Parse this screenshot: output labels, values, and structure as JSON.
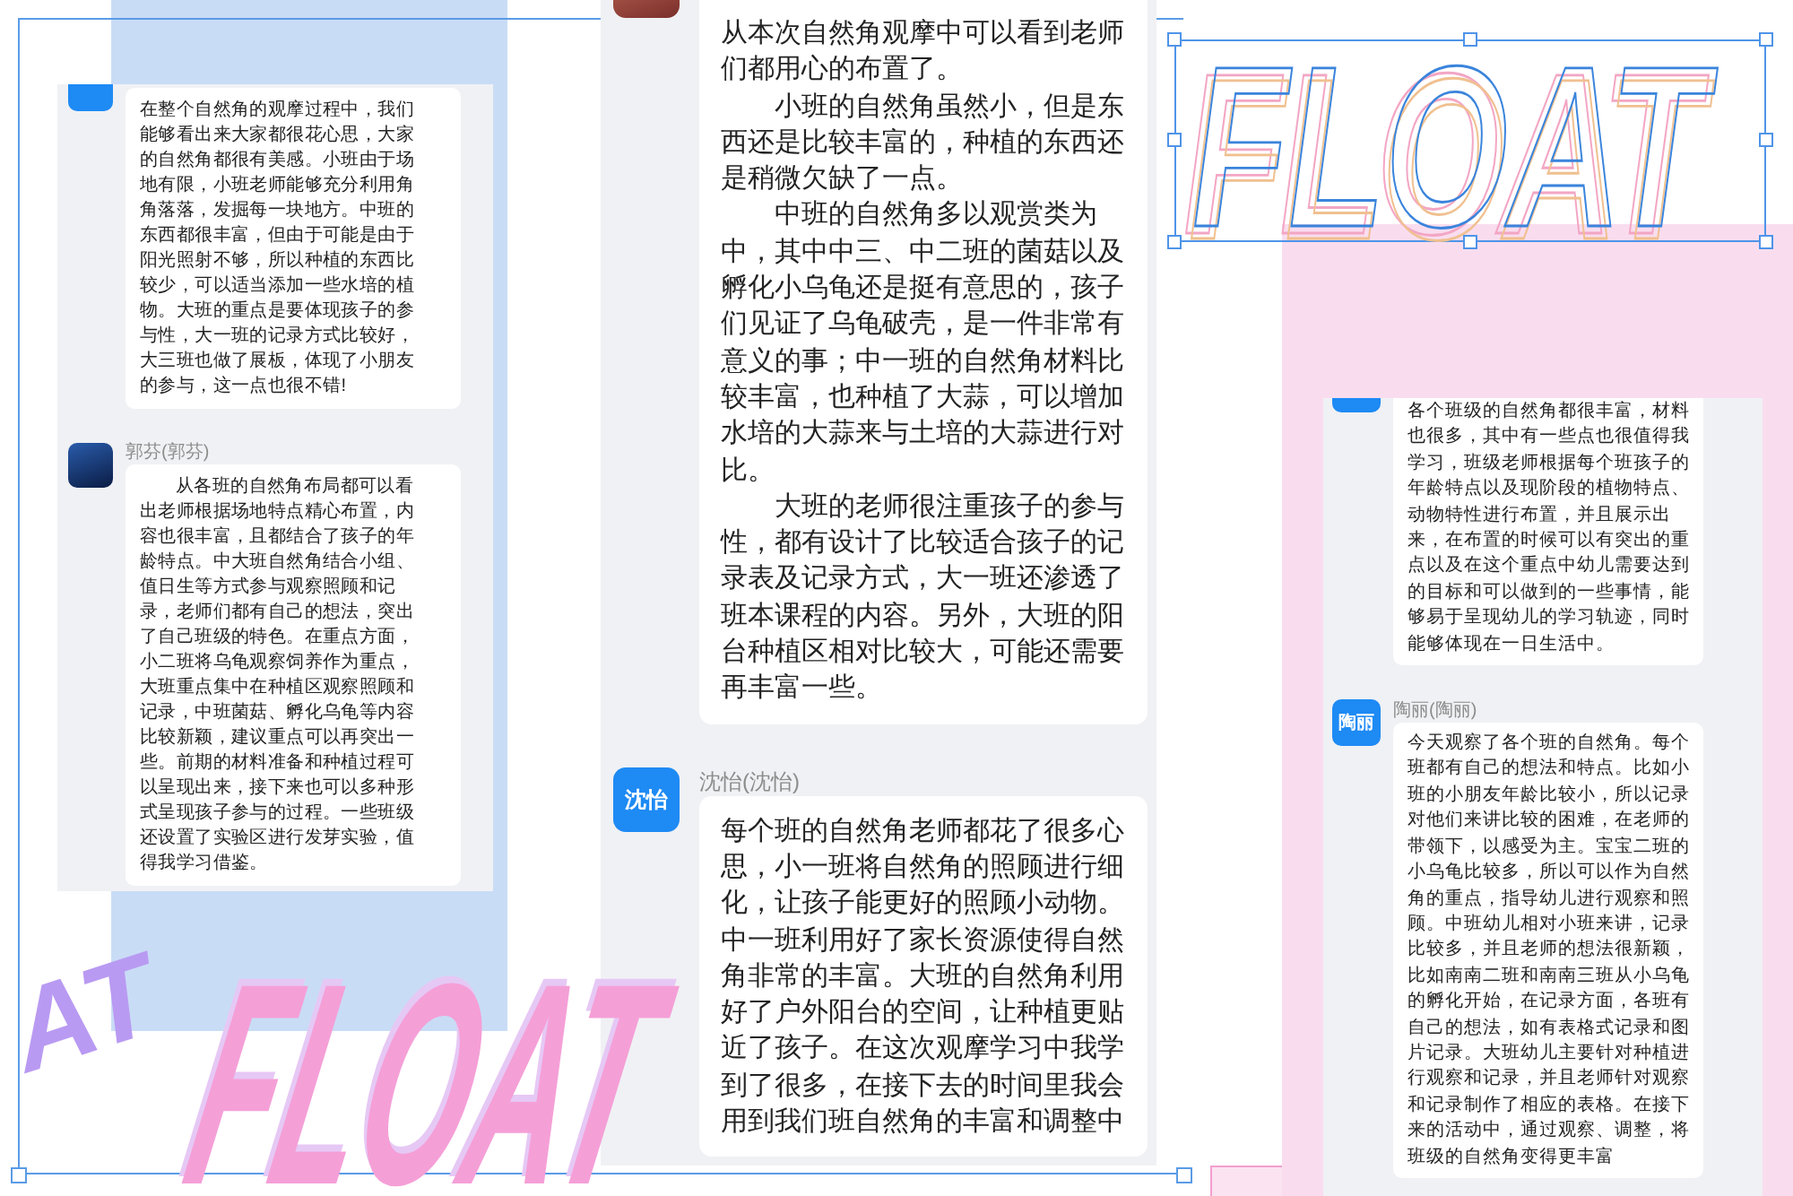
{
  "chat_panels": [
    {
      "messages": [
        {
          "avatar": {
            "kind": "tile"
          },
          "paragraphs": [
            {
              "text": "在整个自然角的观摩过程中，我们能够看出来大家都很花心思，大家的自然角都很有美感。小班由于场地有限，小班老师能够充分利用角角落落，发掘每一块地方。中班的东西都很丰富，但由于可能是由于阳光照射不够，所以种植的东西比较少，可以适当添加一些水培的植物。大班的重点是要体现孩子的参与性，大一班的记录方式比较好，大三班也做了展板，体现了小朋友的参与，这一点也很不错!",
              "indent": false
            }
          ]
        },
        {
          "sender": "郭芬(郭芬)",
          "avatar": {
            "kind": "photo"
          },
          "paragraphs": [
            {
              "text": "从各班的自然角布局都可以看出老师根据场地特点精心布置，内容也很丰富，且都结合了孩子的年龄特点。中大班自然角结合小组、值日生等方式参与观察照顾和记录，老师们都有自己的想法，突出了自己班级的特色。在重点方面，小二班将乌龟观察饲养作为重点，大班重点集中在种植区观察照顾和记录，中班菌菇、孵化乌龟等内容比较新颖，建议重点可以再突出一些。前期的材料准备和种植过程可以呈现出来，接下来也可以多种形式呈现孩子参与的过程。一些班级还设置了实验区进行发芽实验，值得我学习借鉴。",
              "indent": true
            }
          ]
        }
      ]
    },
    {
      "messages": [
        {
          "avatar": {
            "kind": "photo"
          },
          "paragraphs": [
            {
              "text": "从本次自然角观摩中可以看到老师们都用心的布置了。",
              "indent": false
            },
            {
              "text": "小班的自然角虽然小，但是东西还是比较丰富的，种植的东西还是稍微欠缺了一点。",
              "indent": true
            },
            {
              "text": "中班的自然角多以观赏类为中，其中中三、中二班的菌菇以及孵化小乌龟还是挺有意思的，孩子们见证了乌龟破壳，是一件非常有意义的事；中一班的自然角材料比较丰富，也种植了大蒜，可以增加水培的大蒜来与土培的大蒜进行对比。",
              "indent": true
            },
            {
              "text": "大班的老师很注重孩子的参与性，都有设计了比较适合孩子的记录表及记录方式，大一班还渗透了班本课程的内容。另外，大班的阳台种植区相对比较大，可能还需要再丰富一些。",
              "indent": true
            }
          ]
        },
        {
          "sender": "沈怡(沈怡)",
          "avatar": {
            "kind": "tile",
            "label": "沈怡"
          },
          "paragraphs": [
            {
              "text": "每个班的自然角老师都花了很多心思，小一班将自然角的照顾进行细化，让孩子能更好的照顾小动物。中一班利用好了家长资源使得自然角非常的丰富。大班的自然角利用好了户外阳台的空间，让种植更贴近了孩子。在这次观摩学习中我学到了很多，在接下去的时间里我会用到我们班自然角的丰富和调整中",
              "indent": false
            }
          ]
        }
      ]
    },
    {
      "messages": [
        {
          "avatar": {
            "kind": "tile"
          },
          "paragraphs": [
            {
              "text": "各个班级的自然角都很丰富，材料也很多，其中有一些点也很值得我学习，班级老师根据每个班孩子的年龄特点以及现阶段的植物特点、动物特性进行布置，并且展示出来，在布置的时候可以有突出的重点以及在这个重点中幼儿需要达到的目标和可以做到的一些事情，能够易于呈现幼儿的学习轨迹，同时能够体现在一日生活中。",
              "indent": false
            }
          ]
        },
        {
          "sender": "陶丽(陶丽)",
          "avatar": {
            "kind": "tile",
            "label": "陶丽"
          },
          "paragraphs": [
            {
              "text": "今天观察了各个班的自然角。每个班都有自己的想法和特点。比如小班的小朋友年龄比较小，所以记录对他们来讲比较的困难，在老师的带领下，以感受为主。宝宝二班的小乌龟比较多，所以可以作为自然角的重点，指导幼儿进行观察和照顾。中班幼儿相对小班来讲，记录比较多，并且老师的想法很新颖，比如南南二班和南南三班从小乌龟的孵化开始，在记录方面，各班有自己的想法，如有表格式记录和图片记录。大班幼儿主要针对种植进行观察和记录，并且老师针对观察和记录制作了相应的表格。在接下来的活动中，通过观察、调整，将班级的自然角变得更丰富",
              "indent": false
            }
          ]
        }
      ]
    }
  ],
  "artwork": [
    {
      "kind": "outline",
      "text": "FLOAT"
    },
    {
      "kind": "tilted",
      "text": "AT"
    },
    {
      "kind": "bold",
      "text": "FLOAT"
    }
  ]
}
